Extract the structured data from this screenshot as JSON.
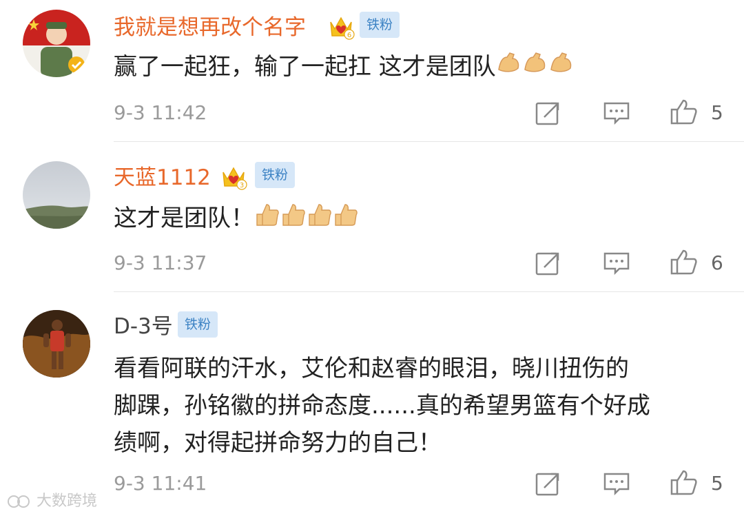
{
  "comments": [
    {
      "username": "我就是想再改个名字",
      "level": "6",
      "badge": "铁粉",
      "text": "赢了一起狂，输了一起扛 这才是团队",
      "emoji": "flexed-biceps",
      "emoji_count": 3,
      "timestamp": "9-3 11:42",
      "likes": "5"
    },
    {
      "username": "天蓝1112",
      "level": "3",
      "badge": "铁粉",
      "text": "这才是团队！",
      "emoji": "thumbs-up",
      "emoji_count": 4,
      "timestamp": "9-3 11:37",
      "likes": "6"
    },
    {
      "username": "D-3号",
      "badge": "铁粉",
      "text_lines": [
        "看看阿联的汗水，艾伦和赵睿的眼泪，晓川扭伤的",
        "脚踝，孙铭徽的拼命态度......真的希望男篮有个好成",
        "绩啊，对得起拼命努力的自己！"
      ],
      "timestamp": "9-3 11:41",
      "likes": "5"
    }
  ],
  "watermark": "大数跨境",
  "colors": {
    "username": "#e8682b",
    "badge_bg": "#d6e7f8",
    "badge_text": "#3d83c4",
    "meta": "#9a9a9a"
  }
}
